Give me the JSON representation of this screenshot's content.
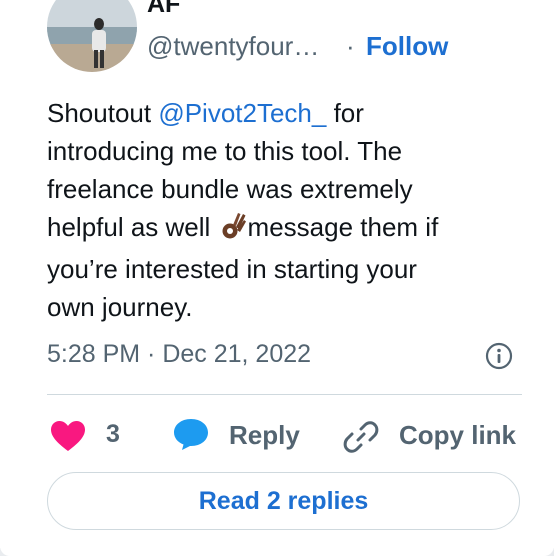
{
  "tweet": {
    "author_name": "AF",
    "author_handle": "@twentyfour…",
    "separator": "·",
    "follow_label": "Follow",
    "text_lines": {
      "l1_pre": "Shoutout ",
      "l1_mention": "@Pivot2Tech_",
      "l1_post": " for",
      "l2": "introducing me to this tool. The",
      "l3": "freelance bundle was extremely",
      "l4_pre": "helpful as well ",
      "l4_post": "message them if",
      "l5": "you’re interested in starting your",
      "l6": "own journey."
    },
    "emoji_icon": "ok-hand-emoji-icon",
    "timestamp": "5:28 PM · Dec 21, 2022"
  },
  "actions": {
    "like_count": "3",
    "reply_label": "Reply",
    "copy_link_label": "Copy link"
  },
  "read_replies_label": "Read 2 replies",
  "colors": {
    "accent": "#1d6fd1",
    "heart": "#f91880",
    "secondary_text": "#536471"
  }
}
